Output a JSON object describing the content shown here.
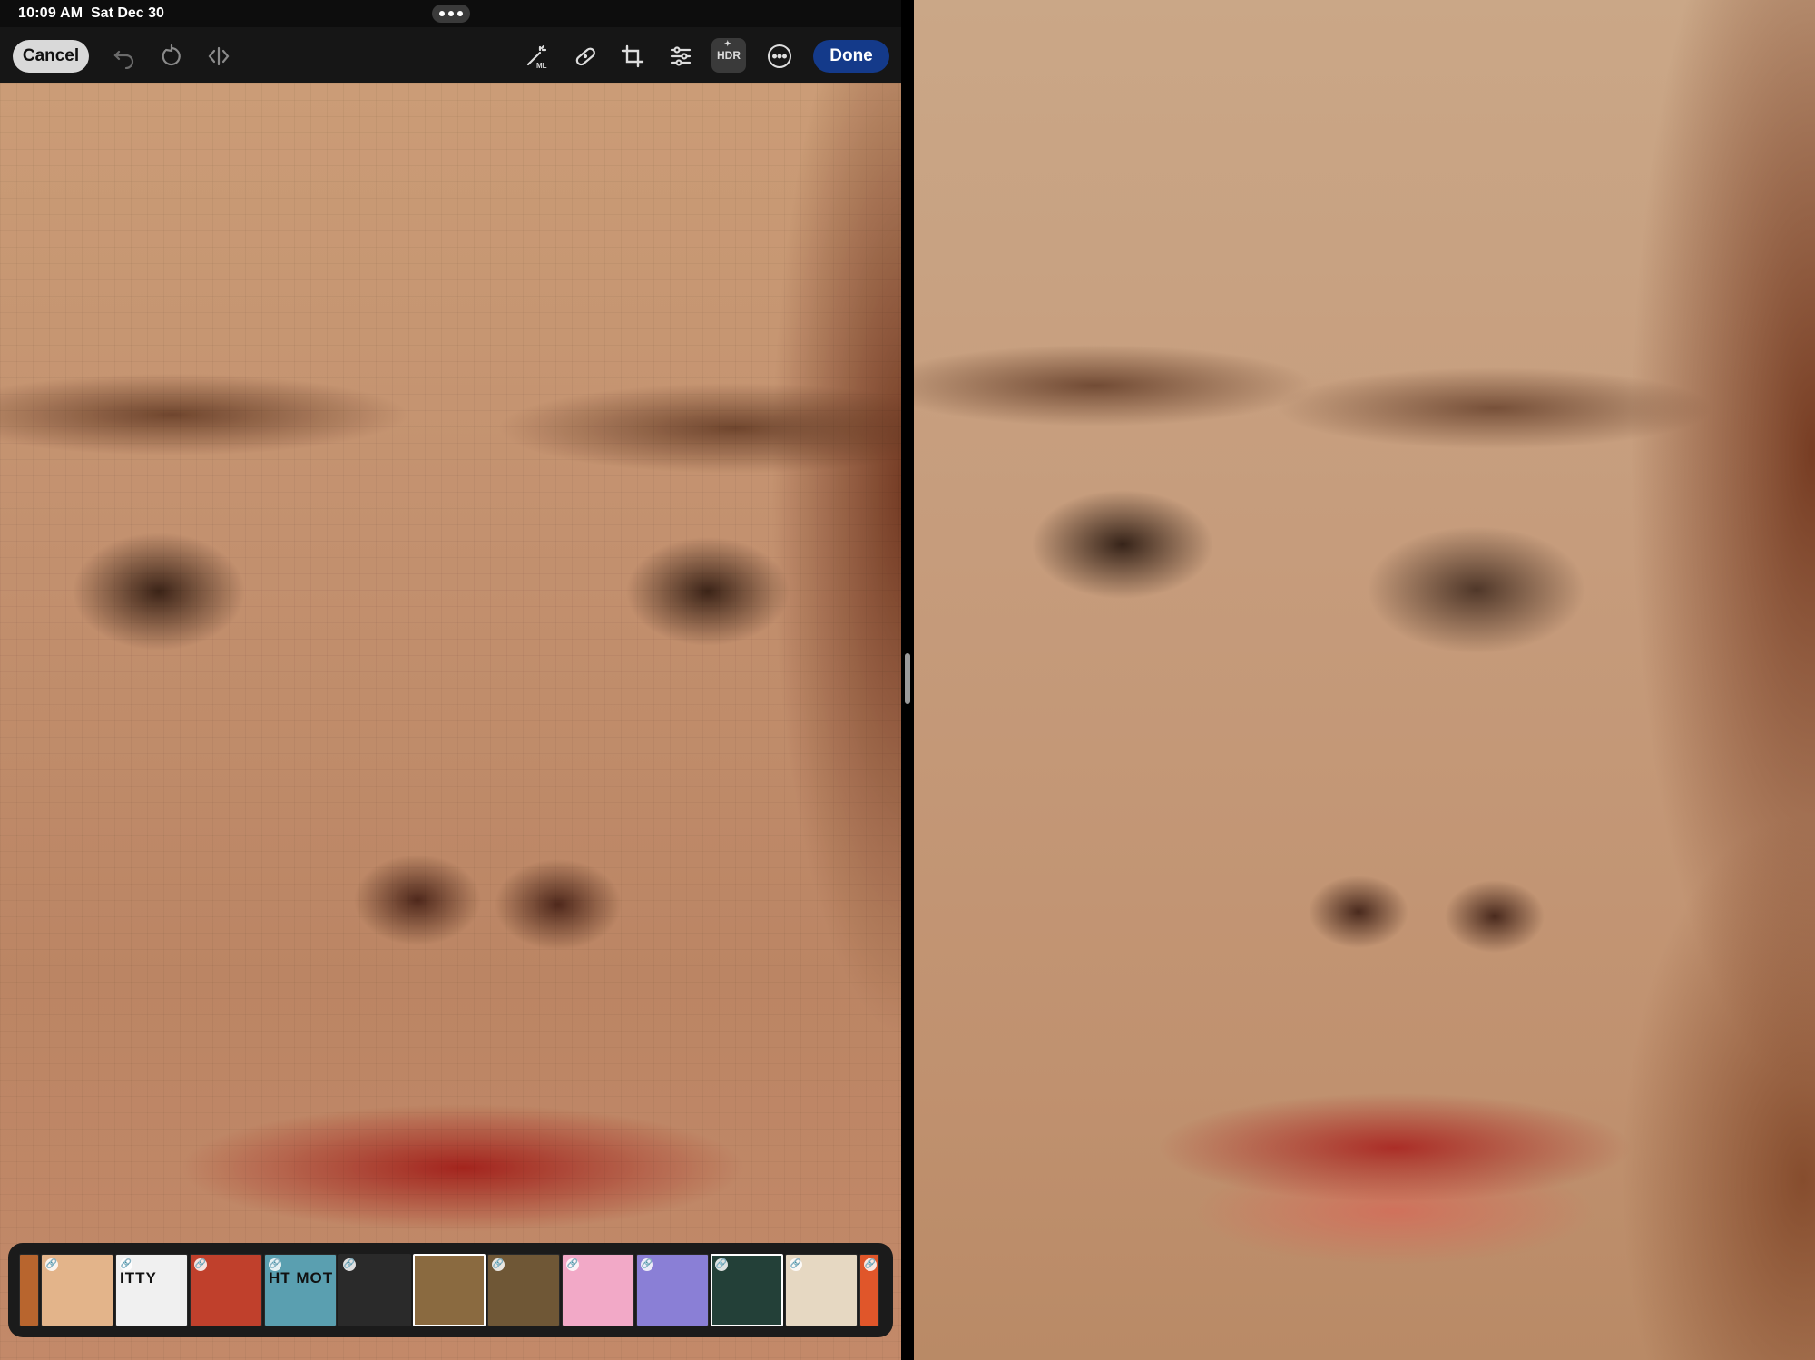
{
  "status": {
    "time": "10:09 AM",
    "date": "Sat Dec 30"
  },
  "toolbar": {
    "cancel_label": "Cancel",
    "hdr_label": "HDR",
    "done_label": "Done",
    "icons": [
      "undo-icon",
      "redo-icon",
      "compare-icon",
      "magic-wand-ml-icon",
      "bandage-icon",
      "crop-icon",
      "adjust-icon",
      "hdr-icon",
      "more-icon"
    ],
    "ml_badge": "ML"
  },
  "filmstrip": {
    "thumbnails": [
      {
        "label": "",
        "color": "#b8652e",
        "linked": false
      },
      {
        "label": "",
        "color": "#e3b48a",
        "linked": true
      },
      {
        "label": "ITTY",
        "color": "#f0f0f0",
        "linked": true
      },
      {
        "label": "",
        "color": "#c0402c",
        "linked": true
      },
      {
        "label": "HT MOTEL",
        "color": "#5a9fb0",
        "linked": true
      },
      {
        "label": "",
        "color": "#2a2a2a",
        "linked": true
      },
      {
        "label": "",
        "color": "#8a6a40",
        "linked": false,
        "selected": true
      },
      {
        "label": "",
        "color": "#6f5736",
        "linked": true
      },
      {
        "label": "",
        "color": "#f2a9c7",
        "linked": true
      },
      {
        "label": "",
        "color": "#8a7fd6",
        "linked": true
      },
      {
        "label": "",
        "color": "#234038",
        "linked": true,
        "selected": true
      },
      {
        "label": "",
        "color": "#e6d8c2",
        "linked": true
      },
      {
        "label": "",
        "color": "#e0562a",
        "linked": true
      }
    ]
  }
}
